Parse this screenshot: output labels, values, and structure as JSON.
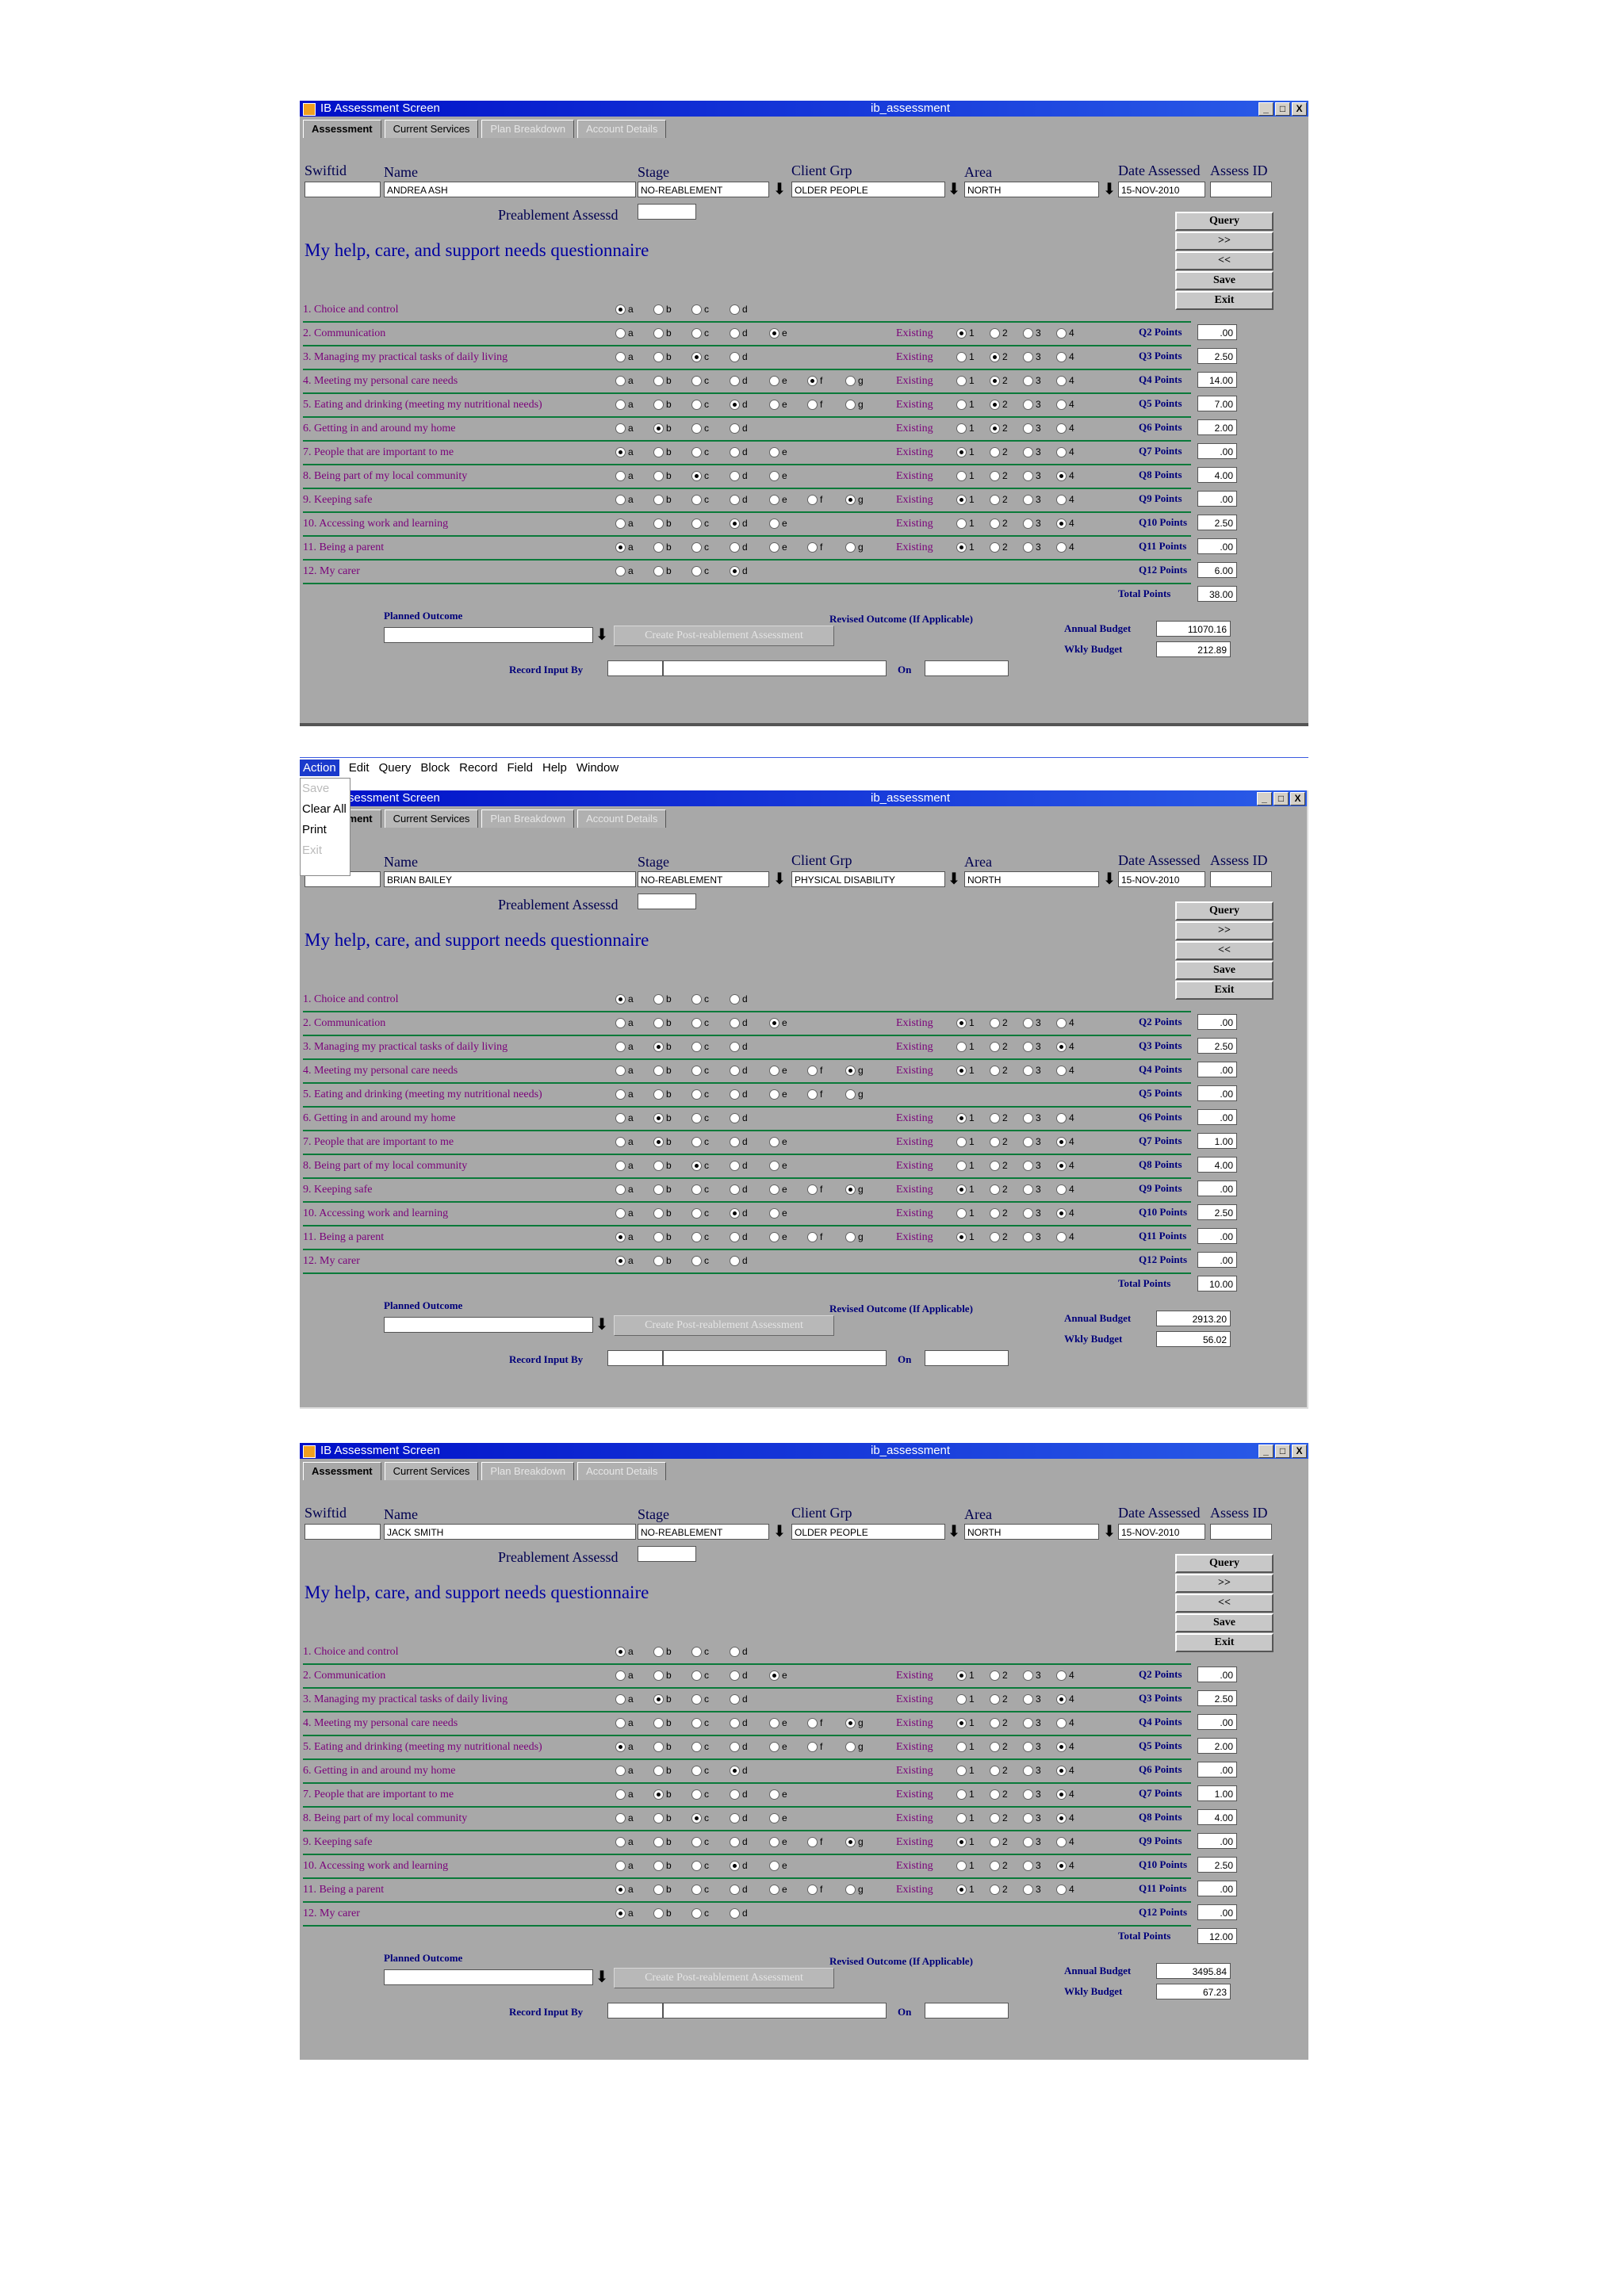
{
  "app": {
    "window_title": "IB Assessment Screen",
    "window_center": "ib_assessment",
    "min": "_",
    "max": "□",
    "close": "X"
  },
  "tabs": {
    "assessment": "Assessment",
    "current_services": "Current Services",
    "plan_breakdown": "Plan Breakdown",
    "account_details": "Account Details"
  },
  "labels": {
    "swiftid": "Swiftid",
    "name": "Name",
    "stage": "Stage",
    "client_grp": "Client Grp",
    "area": "Area",
    "date_assessed": "Date Assessed",
    "assess_id": "Assess ID",
    "preablement": "Preablement Assessd",
    "questionnaire": "My help, care, and support needs questionnaire",
    "existing": "Existing",
    "total_points": "Total Points",
    "planned_outcome": "Planned Outcome",
    "revised_outcome": "Revised Outcome (If Applicable)",
    "create_post": "Create Post-reablement Assessment",
    "annual_budget": "Annual Budget",
    "wkly_budget": "Wkly Budget",
    "record_input": "Record Input By",
    "on": "On"
  },
  "side_buttons": [
    "Query",
    ">>",
    "<<",
    "Save",
    "Exit"
  ],
  "questions": [
    {
      "n": "1.",
      "label": "Choice and control",
      "opts": [
        "a",
        "b",
        "c",
        "d"
      ],
      "pts": ""
    },
    {
      "n": "2.",
      "label": "Communication",
      "opts": [
        "a",
        "b",
        "c",
        "d",
        "e"
      ],
      "pts": "Q2 Points"
    },
    {
      "n": "3.",
      "label": "Managing my practical tasks of daily living",
      "opts": [
        "a",
        "b",
        "c",
        "d"
      ],
      "pts": "Q3 Points"
    },
    {
      "n": "4.",
      "label": "Meeting my personal care needs",
      "opts": [
        "a",
        "b",
        "c",
        "d",
        "e",
        "f",
        "g"
      ],
      "pts": "Q4 Points"
    },
    {
      "n": "5.",
      "label": "Eating and drinking (meeting my nutritional needs)",
      "opts": [
        "a",
        "b",
        "c",
        "d",
        "e",
        "f",
        "g"
      ],
      "pts": "Q5 Points"
    },
    {
      "n": "6.",
      "label": "Getting in and around my home",
      "opts": [
        "a",
        "b",
        "c",
        "d"
      ],
      "pts": "Q6 Points"
    },
    {
      "n": "7.",
      "label": "People that are important to me",
      "opts": [
        "a",
        "b",
        "c",
        "d",
        "e"
      ],
      "pts": "Q7 Points"
    },
    {
      "n": "8.",
      "label": "Being part of my local community",
      "opts": [
        "a",
        "b",
        "c",
        "d",
        "e"
      ],
      "pts": "Q8 Points"
    },
    {
      "n": "9.",
      "label": "Keeping safe",
      "opts": [
        "a",
        "b",
        "c",
        "d",
        "e",
        "f",
        "g"
      ],
      "pts": "Q9 Points"
    },
    {
      "n": "10.",
      "label": "Accessing work and learning",
      "opts": [
        "a",
        "b",
        "c",
        "d",
        "e"
      ],
      "pts": "Q10 Points"
    },
    {
      "n": "11.",
      "label": "Being a parent",
      "opts": [
        "a",
        "b",
        "c",
        "d",
        "e",
        "f",
        "g"
      ],
      "pts": "Q11 Points"
    },
    {
      "n": "12.",
      "label": "My carer",
      "opts": [
        "a",
        "b",
        "c",
        "d"
      ],
      "pts": "Q12 Points"
    }
  ],
  "existing_opts": [
    "1",
    "2",
    "3",
    "4"
  ],
  "menu": {
    "items": [
      "Action",
      "Edit",
      "Query",
      "Block",
      "Record",
      "Field",
      "Help",
      "Window"
    ],
    "dropdown": [
      "Save",
      "Clear All",
      "Print",
      "Exit"
    ]
  },
  "screens": [
    {
      "name": "ANDREA ASH",
      "stage": "NO-REABLEMENT",
      "client_grp": "OLDER PEOPLE",
      "area": "NORTH",
      "date": "15-NOV-2010",
      "sel": [
        0,
        4,
        2,
        5,
        3,
        1,
        0,
        2,
        6,
        3,
        0,
        3
      ],
      "ex": [
        null,
        0,
        1,
        1,
        1,
        1,
        0,
        3,
        0,
        3,
        0,
        null
      ],
      "points": [
        "",
        ".00",
        "2.50",
        "14.00",
        "7.00",
        "2.00",
        ".00",
        "4.00",
        ".00",
        "2.50",
        ".00",
        "6.00"
      ],
      "total": "38.00",
      "annual": "11070.16",
      "wkly": "212.89"
    },
    {
      "name": "BRIAN BAILEY",
      "stage": "NO-REABLEMENT",
      "client_grp": "PHYSICAL DISABILITY",
      "area": "NORTH",
      "date": "15-NOV-2010",
      "sel": [
        0,
        4,
        1,
        6,
        null,
        1,
        1,
        2,
        6,
        3,
        0,
        0
      ],
      "ex": [
        null,
        0,
        3,
        0,
        null,
        0,
        3,
        3,
        0,
        3,
        0,
        null
      ],
      "points": [
        "",
        ".00",
        "2.50",
        ".00",
        ".00",
        ".00",
        "1.00",
        "4.00",
        ".00",
        "2.50",
        ".00",
        ".00"
      ],
      "total": "10.00",
      "annual": "2913.20",
      "wkly": "56.02"
    },
    {
      "name": "JACK SMITH",
      "stage": "NO-REABLEMENT",
      "client_grp": "OLDER PEOPLE",
      "area": "NORTH",
      "date": "15-NOV-2010",
      "sel": [
        0,
        4,
        1,
        6,
        0,
        3,
        1,
        2,
        6,
        3,
        0,
        0
      ],
      "ex": [
        null,
        0,
        3,
        0,
        3,
        3,
        3,
        3,
        0,
        3,
        0,
        null
      ],
      "points": [
        "",
        ".00",
        "2.50",
        ".00",
        "2.00",
        ".00",
        "1.00",
        "4.00",
        ".00",
        "2.50",
        ".00",
        ".00"
      ],
      "total": "12.00",
      "annual": "3495.84",
      "wkly": "67.23"
    }
  ]
}
